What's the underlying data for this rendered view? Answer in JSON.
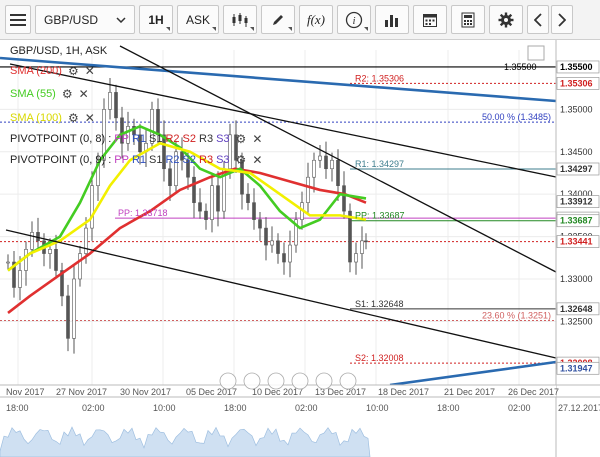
{
  "toolbar": {
    "symbol": "GBP/USD",
    "timeframe": "1H",
    "price_side": "ASK",
    "fx_label": "f(x)",
    "info_label": "i"
  },
  "chart": {
    "title": "GBP/USD, 1H, ASK",
    "indicators": [
      {
        "label": "SMA (200)",
        "color": "#e03030"
      },
      {
        "label": "SMA (55)",
        "color": "#44cc22"
      },
      {
        "label": "SMA (100)",
        "color": "#d8d800"
      }
    ],
    "pivot_rows": [
      {
        "prefix": "PIVOTPOINT (0, 8) :",
        "parts": [
          {
            "t": "PP",
            "c": "#c040c0"
          },
          {
            "t": "R1",
            "c": "#3050c0"
          },
          {
            "t": "S1",
            "c": "#333333"
          },
          {
            "t": "R2",
            "c": "#d02020"
          },
          {
            "t": "S2",
            "c": "#d02020"
          },
          {
            "t": "R3",
            "c": "#333333"
          },
          {
            "t": "S3",
            "c": "#6040c0"
          }
        ]
      },
      {
        "prefix": "PIVOTPOINT (0, 9) :",
        "parts": [
          {
            "t": "PP",
            "c": "#c040c0"
          },
          {
            "t": "R1",
            "c": "#3050c0"
          },
          {
            "t": "S1",
            "c": "#333333"
          },
          {
            "t": "R2",
            "c": "#3050c0"
          },
          {
            "t": "S2",
            "c": "#3050c0"
          },
          {
            "t": "R3",
            "c": "#d02020"
          },
          {
            "t": "S3",
            "c": "#6040c0"
          }
        ]
      }
    ],
    "level_labels": [
      {
        "text": "R2: 1.35306",
        "price": 1.35306,
        "color": "#d02020"
      },
      {
        "text": "50.00 % (1.3485)",
        "price": 1.3485,
        "color": "#3040c0"
      },
      {
        "text": "R1: 1.34297",
        "price": 1.34297,
        "color": "#3d7d8d"
      },
      {
        "text": "PP: 1.33718",
        "price": 1.33718,
        "color": "#c040c0"
      },
      {
        "text": "PP: 1.33687",
        "price": 1.33687,
        "color": "#228822"
      },
      {
        "text": "S1: 1.32648",
        "price": 1.32648,
        "color": "#333333"
      },
      {
        "text": "23.60 % (1.3251)",
        "price": 1.3251,
        "color": "#d06060"
      },
      {
        "text": "S2: 1.32008",
        "price": 1.32008,
        "color": "#d02020"
      }
    ],
    "price_axis": {
      "ticks": [
        "1.35500",
        "1.35000",
        "1.34500",
        "1.34000",
        "1.33500",
        "1.33000",
        "1.32500"
      ],
      "tick_values": [
        1.355,
        1.35,
        1.345,
        1.34,
        1.335,
        1.33,
        1.325
      ],
      "tags": [
        {
          "text": "1.35500",
          "price": 1.355,
          "bg": "#ffffff",
          "fg": "#000000"
        },
        {
          "text": "1.35306",
          "price": 1.35306,
          "bg": "#ffffff",
          "fg": "#d02020"
        },
        {
          "text": "1.34297",
          "price": 1.34297,
          "bg": "#ffffff",
          "fg": "#333333"
        },
        {
          "text": "1.33912",
          "price": 1.33912,
          "bg": "#ffffff",
          "fg": "#333333"
        },
        {
          "text": "1.33718",
          "price": 1.33718,
          "bg": "#ffffff",
          "fg": "#c040c0"
        },
        {
          "text": "1.33687",
          "price": 1.33687,
          "bg": "#ffffff",
          "fg": "#228822"
        },
        {
          "text": "1.33441",
          "price": 1.33441,
          "bg": "#ffffff",
          "fg": "#d02020"
        },
        {
          "text": "1.32648",
          "price": 1.32648,
          "bg": "#ffffff",
          "fg": "#333333"
        },
        {
          "text": "1.32008",
          "price": 1.32008,
          "bg": "#ffffff",
          "fg": "#d02020"
        },
        {
          "text": "1.31947",
          "price": 1.31947,
          "bg": "#ffffff",
          "fg": "#3050a0"
        }
      ],
      "line_label": "1.35500"
    },
    "date_labels": [
      "Nov 2017",
      "27 Nov 2017",
      "30 Nov 2017",
      "05 Dec 2017",
      "10 Dec 2017",
      "13 Dec 2017",
      "18 Dec 2017",
      "21 Dec 2017",
      "26 Dec 2017"
    ],
    "time_labels": [
      "18:00",
      "02:00",
      "10:00",
      "18:00",
      "02:00",
      "10:00",
      "18:00",
      "02:00"
    ],
    "time_axis_end": "27.12.2017",
    "colors": {
      "sma200": "#e03030",
      "sma55": "#44cc22",
      "sma100": "#f2f000",
      "candle": "#555555",
      "trend_blue": "#2a6ab0",
      "trend_black": "#111111"
    }
  }
}
